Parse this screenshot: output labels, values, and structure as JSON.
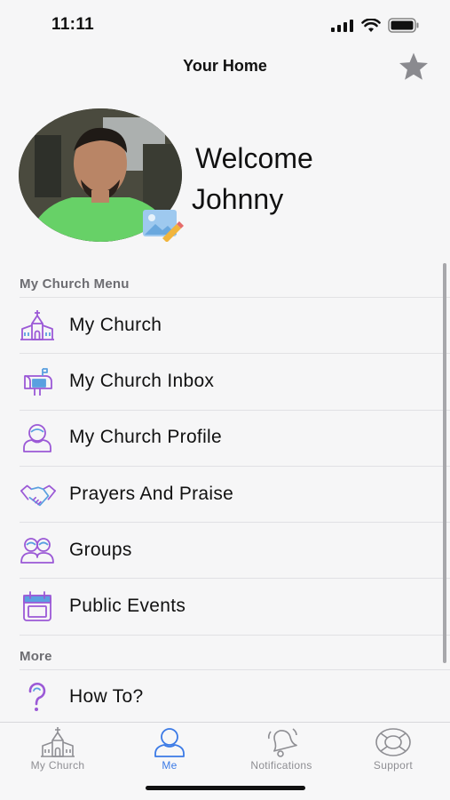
{
  "status_bar": {
    "time": "11:11"
  },
  "nav": {
    "title": "Your Home"
  },
  "profile": {
    "welcome_line1": "Welcome",
    "welcome_line2": "Johnny"
  },
  "sections": {
    "my_church_menu": {
      "header": "My Church Menu"
    },
    "more": {
      "header": "More"
    }
  },
  "menu": {
    "items": [
      {
        "label": "My Church",
        "icon": "church-icon"
      },
      {
        "label": "My Church Inbox",
        "icon": "mailbox-icon"
      },
      {
        "label": "My Church Profile",
        "icon": "person-icon"
      },
      {
        "label": "Prayers And Praise",
        "icon": "handshake-icon"
      },
      {
        "label": "Groups",
        "icon": "group-icon"
      },
      {
        "label": "Public Events",
        "icon": "calendar-icon"
      }
    ],
    "more_items": [
      {
        "label": "How To?",
        "icon": "question-icon"
      }
    ]
  },
  "tabs": [
    {
      "label": "My Church",
      "icon": "church-icon"
    },
    {
      "label": "Me",
      "icon": "person-icon",
      "active": true
    },
    {
      "label": "Notifications",
      "icon": "bell-icon"
    },
    {
      "label": "Support",
      "icon": "lifebuoy-icon"
    }
  ],
  "colors": {
    "accent": "#3b7ae6",
    "icon_purple": "#9b59d6",
    "icon_blue": "#5aa0e0"
  }
}
